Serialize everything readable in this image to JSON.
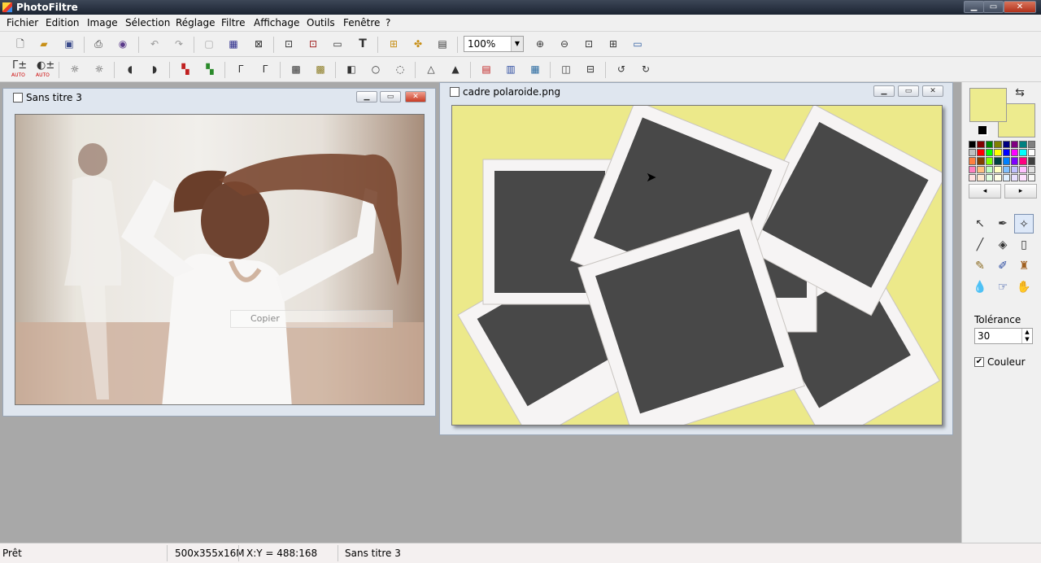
{
  "app": {
    "title": "PhotoFiltre"
  },
  "window_buttons": {
    "minimize": "▁",
    "restore": "▭",
    "close": "✕"
  },
  "menu": [
    "Fichier",
    "Edition",
    "Image",
    "Sélection",
    "Réglage",
    "Filtre",
    "Affichage",
    "Outils",
    "Fenêtre",
    "?"
  ],
  "toolbar1": {
    "zoom_value": "100%"
  },
  "toolbar2": {
    "auto_label": "AUTO"
  },
  "doc1": {
    "title": "Sans titre 3",
    "ghost_text": "Copier"
  },
  "doc2": {
    "title": "cadre polaroide.png"
  },
  "colors": {
    "foreground": "#edeb8e",
    "background": "#edeb8e",
    "canvas_bg": "#ece98a",
    "polaroid_frame": "#f6f4f4",
    "polaroid_photo": "#484848"
  },
  "right_panel": {
    "tolerance_label": "Tolérance",
    "tolerance_value": "30",
    "couleur_label": "Couleur",
    "couleur_checked": true
  },
  "palette": [
    "#000000",
    "#800000",
    "#008000",
    "#808000",
    "#000080",
    "#800080",
    "#008080",
    "#808080",
    "#c0c0c0",
    "#ff0000",
    "#00ff00",
    "#ffff00",
    "#0000ff",
    "#ff00ff",
    "#00ffff",
    "#ffffff",
    "#ff8040",
    "#804000",
    "#80ff00",
    "#004040",
    "#0080ff",
    "#8000ff",
    "#ff0080",
    "#404040",
    "#ff80c0",
    "#ffc080",
    "#c0ffc0",
    "#ffffc0",
    "#80c0ff",
    "#c0c0ff",
    "#ffc0ff",
    "#e0e0e0",
    "#ffe0e0",
    "#ffe8d0",
    "#e0ffe0",
    "#ffffe8",
    "#e0f0ff",
    "#e8e0ff",
    "#ffe0ff",
    "#f8f8f8"
  ],
  "status": {
    "ready": "Prêt",
    "image_info": "500x355x16M",
    "coords": "X:Y = 488:168",
    "doc_name": "Sans titre 3"
  }
}
